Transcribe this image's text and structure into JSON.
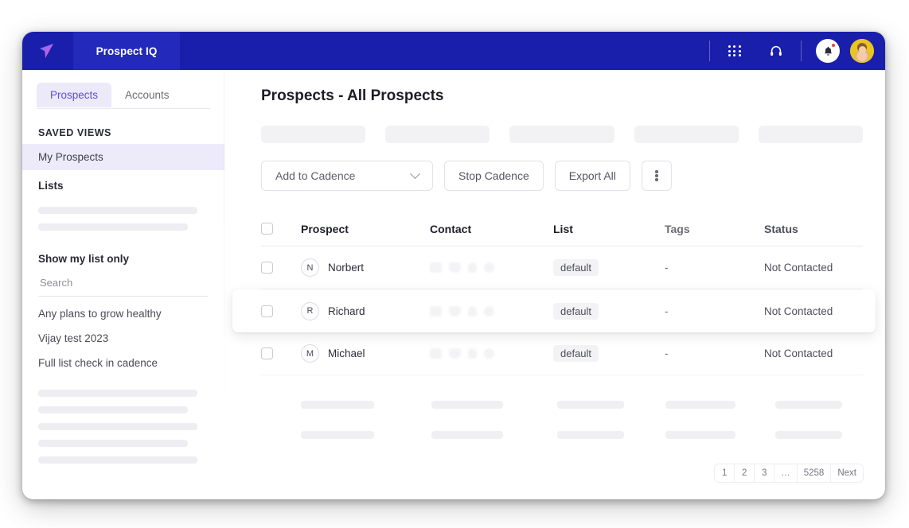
{
  "topnav": {
    "logo_icon": "paper-plane-logo",
    "brand_tab": "Prospect IQ",
    "icons": [
      "dialpad-icon",
      "headset-icon",
      "bell-icon",
      "avatar"
    ]
  },
  "sidebar": {
    "tabs": [
      {
        "label": "Prospects",
        "active": true
      },
      {
        "label": "Accounts",
        "active": false
      }
    ],
    "saved_views_heading": "SAVED VIEWS",
    "saved_views": [
      {
        "label": "My Prospects",
        "selected": true
      }
    ],
    "lists_heading": "Lists",
    "show_my_list_only": "Show my list only",
    "search_placeholder": "Search",
    "list_entries": [
      "Any plans to grow healthy",
      "Vijay test 2023",
      "Full list check in cadence"
    ]
  },
  "main": {
    "page_title": "Prospects - All Prospects",
    "filter_skeleton_count": 5,
    "toolbar": {
      "cadence_select": "Add to Cadence",
      "stop_cadence": "Stop Cadence",
      "export_all": "Export All",
      "kebab": "more-options"
    },
    "table": {
      "headers": [
        "Prospect",
        "Contact",
        "List",
        "Tags",
        "Status"
      ],
      "rows": [
        {
          "initial": "N",
          "name": "Norbert",
          "list": "default",
          "tags": "-",
          "status": "Not Contacted",
          "hovered": false
        },
        {
          "initial": "R",
          "name": "Richard",
          "list": "default",
          "tags": "-",
          "status": "Not Contacted",
          "hovered": true
        },
        {
          "initial": "M",
          "name": "Michael",
          "list": "default",
          "tags": "-",
          "status": "Not Contacted",
          "hovered": false
        }
      ],
      "skeleton_rows": 2
    },
    "pagination": [
      "1",
      "2",
      "3",
      "…",
      "5258",
      "Next"
    ]
  },
  "colors": {
    "navy": "#1a1fab",
    "brand_tab": "#2229bb",
    "accent_purple": "#5b4de0",
    "tab_active_bg": "#eceaf9",
    "selected_bg": "#edebfa",
    "notification_red": "#e8443a"
  }
}
